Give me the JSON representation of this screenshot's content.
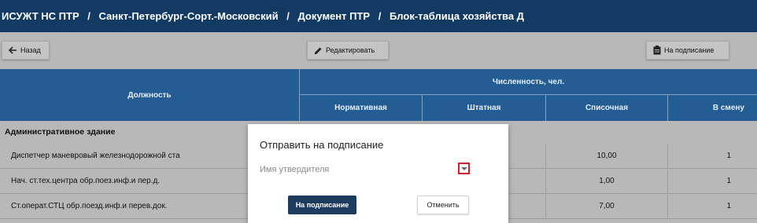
{
  "breadcrumb": {
    "items": [
      "ИСУЖТ НС ПТР",
      "Санкт-Петербург-Сорт.-Московский",
      "Документ ПТР",
      "Блок-таблица хозяйства Д"
    ],
    "separator": "/"
  },
  "toolbar": {
    "back_label": "Назад",
    "edit_label": "Редактировать",
    "sign_label": "На подписание"
  },
  "table": {
    "headers": {
      "position": "Должность",
      "group": "Численность, чел.",
      "normative": "Нормативная",
      "staff": "Штатная",
      "list": "Списочная",
      "shift": "В смену"
    },
    "section": "Административное здание",
    "rows": [
      {
        "position": "Диспетчер маневровый железнодорожной ста",
        "list": "10,00",
        "shift": "1"
      },
      {
        "position": "Нач. ст.тех.центра обр.поез.инф.и пер.д.",
        "list": "1,00",
        "shift": "1"
      },
      {
        "position": "Ст.операт.СТЦ обр.поезд.инф.и перев.док.",
        "list": "7,00",
        "shift": "1"
      }
    ]
  },
  "modal": {
    "title": "Отправить на подписание",
    "field_placeholder": "Имя утвердителя",
    "primary_button": "На подписание",
    "cancel_button": "Отменить"
  },
  "colors": {
    "topbar": "#123a62",
    "table_header": "#245c94",
    "primary_button": "#1c3b5e",
    "highlight": "#d0202a"
  }
}
